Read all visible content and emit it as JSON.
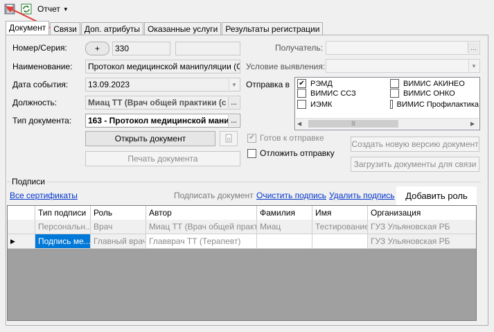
{
  "toolbar": {
    "report_menu": "Отчет"
  },
  "tabs": [
    "Документ",
    "Связи",
    "Доп. атрибуты",
    "Оказанные услуги",
    "Результаты регистрации"
  ],
  "form": {
    "number_label": "Номер/Серия:",
    "plus_button": "+",
    "number_value": "330",
    "series_value": "",
    "name_label": "Наименование:",
    "name_value": "Протокол медицинской манипуляции (CDA",
    "date_label": "Дата события:",
    "date_value": "13.09.2023",
    "position_label": "Должность:",
    "position_value": "Миац ТТ (Врач общей практики (с",
    "doctype_label": "Тип документа:",
    "doctype_value": "163 - Протокол медицинской мани",
    "recipient_label": "Получатель:",
    "recipient_value": "",
    "condition_label": "Условие выявления:",
    "condition_value": "",
    "send_to_label": "Отправка в"
  },
  "send_targets": [
    {
      "label": "РЭМД",
      "checked": true
    },
    {
      "label": "ВИМИС АКИНЕО",
      "checked": false
    },
    {
      "label": "ВИМИС ССЗ",
      "checked": false
    },
    {
      "label": "ВИМИС ОНКО",
      "checked": false
    },
    {
      "label": "ИЭМК",
      "checked": false
    },
    {
      "label": "ВИМИС Профилактика",
      "checked": false
    }
  ],
  "buttons": {
    "open_document": "Открыть документ",
    "print_document": "Печать документа",
    "create_version": "Создать новую версию документ",
    "load_documents": "Загрузить документы для связи"
  },
  "checkboxes": {
    "ready_to_send": "Готов к отправке",
    "postpone_send": "Отложить отправку"
  },
  "signatures": {
    "group_label": "Подписи",
    "all_certificates": "Все сертификаты",
    "sign_document": "Подписать документ",
    "clear_signature": "Очистить подпись",
    "delete_signature": "Удалить подпись",
    "add_role": "Добавить роль",
    "columns": [
      "",
      "Тип подписи",
      "Роль",
      "Автор",
      "Фамилия",
      "Имя",
      "Организация"
    ],
    "rows": [
      [
        "",
        "Персональн...",
        "Врач",
        "Миац ТТ (Врач общей практ...",
        "Миац",
        "Тестирование",
        "ГУЗ Ульяновская РБ"
      ],
      [
        "▶",
        "Подпись ме...",
        "Главный врач",
        "Главврач ТТ (Терапевт)",
        "",
        "",
        "ГУЗ Ульяновская РБ"
      ]
    ]
  },
  "colors": {
    "accent": "#0078d7",
    "link": "#0033cc",
    "arrow": "#e53935"
  }
}
